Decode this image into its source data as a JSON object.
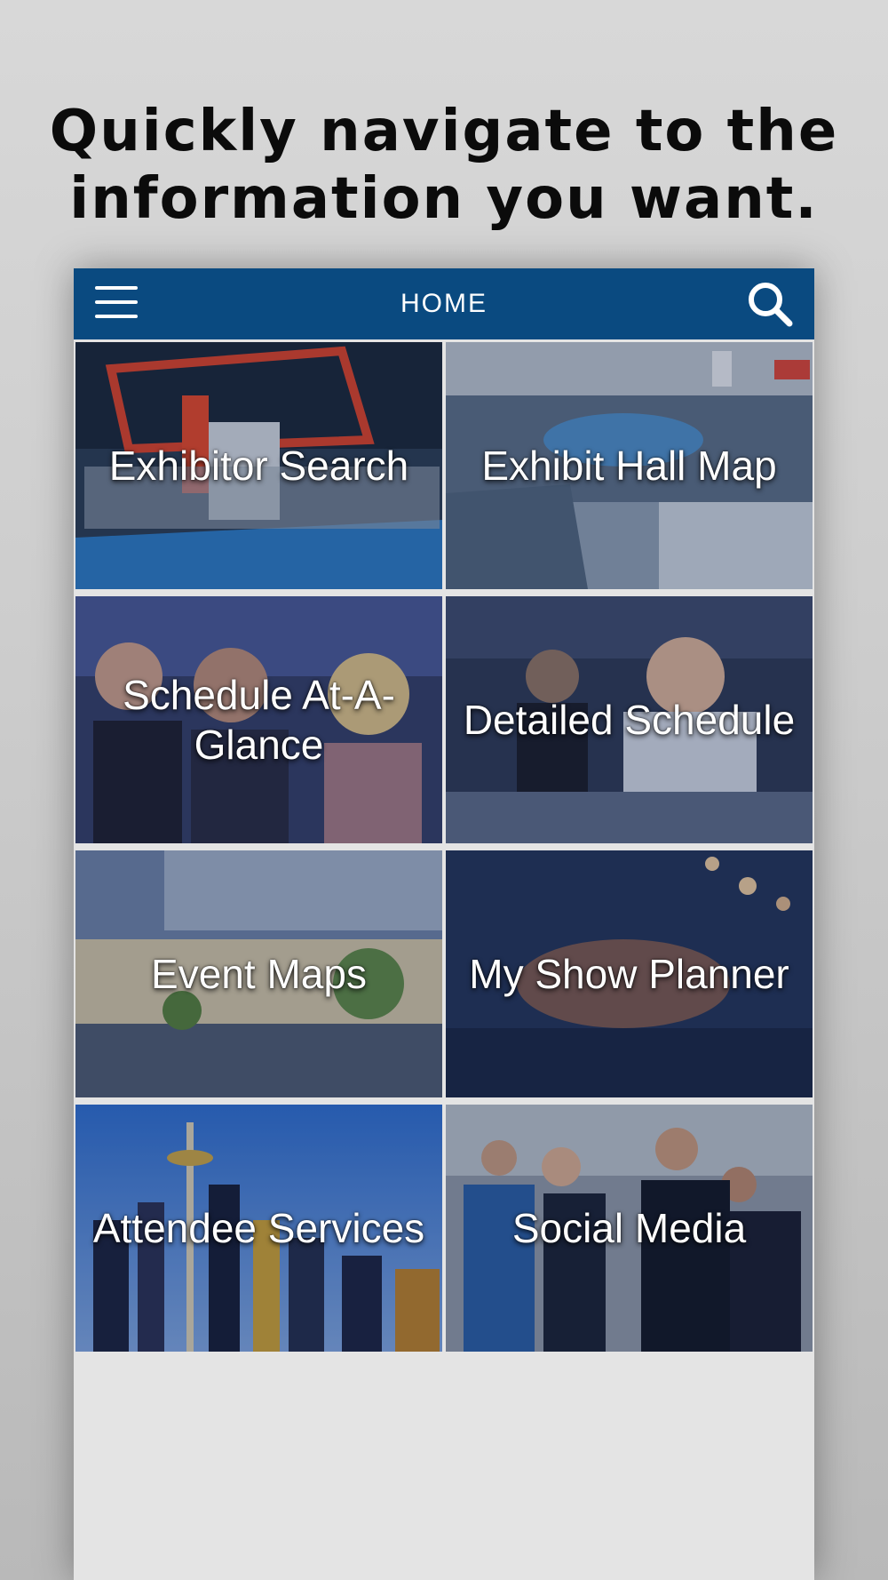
{
  "headline": {
    "line1": "Quickly navigate to the",
    "line2": "information you want."
  },
  "navbar": {
    "title": "HOME",
    "menu_icon": "hamburger-menu-icon",
    "search_icon": "search-icon",
    "color": "#0a4a80"
  },
  "tiles": [
    {
      "label": "Exhibitor Search"
    },
    {
      "label": "Exhibit Hall Map"
    },
    {
      "label": "Schedule At-A-Glance"
    },
    {
      "label": "Detailed Schedule"
    },
    {
      "label": "Event Maps"
    },
    {
      "label": "My Show Planner"
    },
    {
      "label": "Attendee Services"
    },
    {
      "label": "Social Media"
    }
  ]
}
